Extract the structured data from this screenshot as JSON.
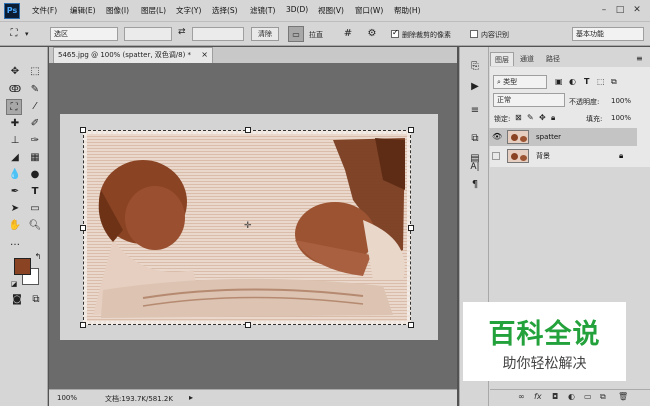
{
  "app": {
    "logo": "Ps"
  },
  "menu": [
    "文件(F)",
    "编辑(E)",
    "图像(I)",
    "图层(L)",
    "文字(Y)",
    "选择(S)",
    "滤镜(T)",
    "3D(D)",
    "视图(V)",
    "窗口(W)",
    "帮助(H)"
  ],
  "options": {
    "ratio_select": "选区",
    "clear_button": "清除",
    "straighten_label": "拉直",
    "delete_cropped_label": "删除裁剪的像素",
    "delete_cropped_checked": true,
    "content_aware_label": "内容识别",
    "content_aware_checked": false,
    "workspace": "基本功能"
  },
  "document": {
    "tab_title": "5465.jpg @ 100% (spatter, 双色调/8) *",
    "zoom": "100%",
    "doc_info": "文档:193.7K/581.2K"
  },
  "layers_panel": {
    "tabs": [
      "图层",
      "通道",
      "路径"
    ],
    "filter": "类型",
    "blend_mode": "正常",
    "opacity_label": "不透明度:",
    "opacity_value": "100%",
    "lock_label": "锁定:",
    "fill_label": "填充:",
    "fill_value": "100%",
    "layers": [
      {
        "name": "spatter",
        "visible": true,
        "selected": true
      },
      {
        "name": "背景",
        "visible": false,
        "selected": false,
        "locked": true
      }
    ],
    "bottom_icons": [
      "link-icon",
      "fx-icon",
      "mask-icon",
      "adjustment-icon",
      "group-icon",
      "new-layer-icon",
      "trash-icon"
    ]
  },
  "colors": {
    "foreground": "#8a4323",
    "background": "#ffffff",
    "accent_green": "#23a23c"
  },
  "watermark": {
    "title": "百科全说",
    "subtitle": "助你轻松解决"
  }
}
